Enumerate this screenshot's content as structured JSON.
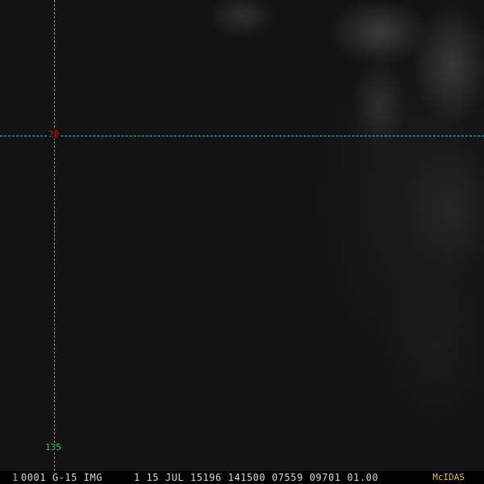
{
  "grid": {
    "latitude_label": "20",
    "longitude_label": "135",
    "line_color": "#2fb8c8",
    "latitude_label_color": "#e01010",
    "longitude_label_color": "#20e020"
  },
  "info_bar": {
    "frame_number": "1",
    "frame_number_color": "#e0c020",
    "text": "0001 G-15 IMG     1 15 JUL 15196 141500 07559 09701 01.00",
    "brand": "McIDAS",
    "brand_color": "#e0c020"
  }
}
